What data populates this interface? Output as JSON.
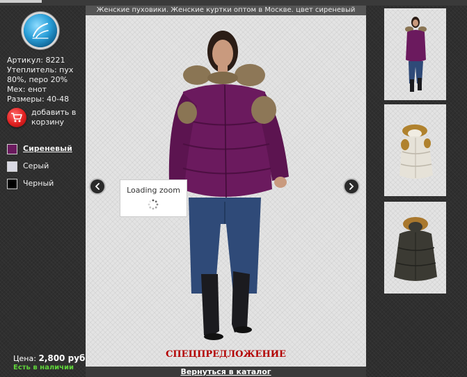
{
  "title": "Женские пуховики. Женские куртки оптом в Москве. цвет сиреневый",
  "product": {
    "article": "Артикул: 8221",
    "insulation": "Утеплитель: пух 80%, перо 20%",
    "fur": "Мех: енот",
    "sizes": "Размеры: 40-48"
  },
  "cart": {
    "label": "добавить в корзину",
    "icon": "cart-icon"
  },
  "colors": [
    {
      "label": "Сиреневый",
      "swatch": "#6b1a5e",
      "selected": true
    },
    {
      "label": "Серый",
      "swatch": "#d9d9e3",
      "selected": false
    },
    {
      "label": "Черный",
      "swatch": "#000000",
      "selected": false
    }
  ],
  "price": {
    "label": "Цена:",
    "value": "2,800 руб."
  },
  "stock": "Есть в наличии",
  "viewer": {
    "loading": "Loading zoom",
    "special": "СПЕЦПРЕДЛОЖЕНИЕ",
    "back": "Вернуться в каталог",
    "prev_icon": "chevron-left-icon",
    "next_icon": "chevron-right-icon"
  },
  "colors_theme": {
    "accent_red": "#b30000",
    "stock_green": "#5fd23a",
    "jacket": "#6b1a5e"
  }
}
